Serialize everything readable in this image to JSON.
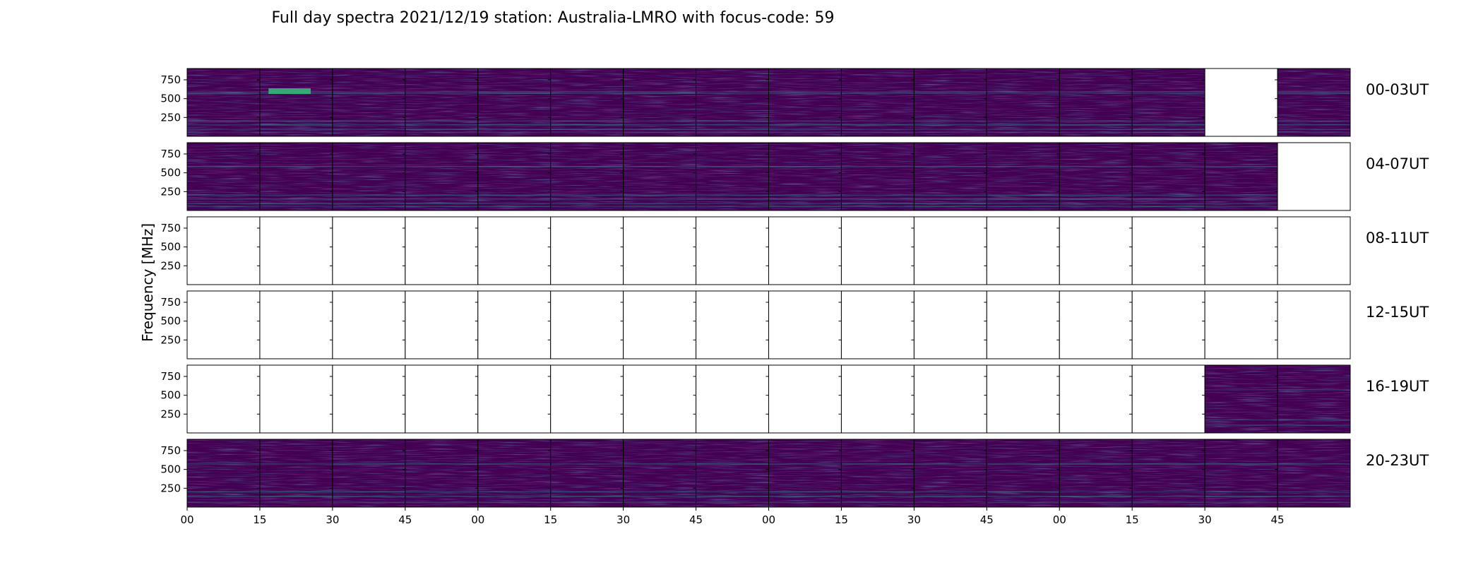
{
  "chart_data": {
    "type": "heatmap",
    "title": "Full day spectra 2021/12/19 station: Australia-LMRO with focus-code: 59",
    "ylabel": "Frequency [MHz]",
    "xlabel": "",
    "y_ticks": [
      "250",
      "500",
      "750"
    ],
    "x_ticks": [
      "00",
      "15",
      "30",
      "45",
      "00",
      "15",
      "30",
      "45",
      "00",
      "15",
      "30",
      "45",
      "00",
      "15",
      "30",
      "45"
    ],
    "colormap": "viridis",
    "background_color": "#440154",
    "rows": [
      {
        "label": "00-03UT",
        "panels": [
          true,
          true,
          true,
          true,
          true,
          true,
          true,
          true,
          true,
          true,
          true,
          true,
          true,
          true,
          false,
          true
        ],
        "bands": [
          {
            "freq": 600,
            "strength": 0.35
          },
          {
            "freq": 580,
            "strength": 0.45
          },
          {
            "freq": 210,
            "strength": 0.4
          },
          {
            "freq": 160,
            "strength": 0.5
          },
          {
            "freq": 100,
            "strength": 0.45
          },
          {
            "freq": 60,
            "strength": 0.4
          }
        ],
        "burst": {
          "panel": 1,
          "freq": 600,
          "strength": 0.9
        }
      },
      {
        "label": "04-07UT",
        "panels": [
          true,
          true,
          true,
          true,
          true,
          true,
          true,
          true,
          true,
          true,
          true,
          true,
          true,
          true,
          true,
          false
        ],
        "bands": [
          {
            "freq": 590,
            "strength": 0.45
          },
          {
            "freq": 210,
            "strength": 0.45
          },
          {
            "freq": 160,
            "strength": 0.5
          },
          {
            "freq": 100,
            "strength": 0.45
          },
          {
            "freq": 60,
            "strength": 0.4
          }
        ]
      },
      {
        "label": "08-11UT",
        "panels": [
          false,
          false,
          false,
          false,
          false,
          false,
          false,
          false,
          false,
          false,
          false,
          false,
          false,
          false,
          false,
          false
        ],
        "bands": []
      },
      {
        "label": "12-15UT",
        "panels": [
          false,
          false,
          false,
          false,
          false,
          false,
          false,
          false,
          false,
          false,
          false,
          false,
          false,
          false,
          false,
          false
        ],
        "bands": []
      },
      {
        "label": "16-19UT",
        "panels": [
          false,
          false,
          false,
          false,
          false,
          false,
          false,
          false,
          false,
          false,
          false,
          false,
          false,
          false,
          true,
          true
        ],
        "bands": [
          {
            "freq": 580,
            "strength": 0.35
          },
          {
            "freq": 180,
            "strength": 0.45
          },
          {
            "freq": 110,
            "strength": 0.4
          }
        ]
      },
      {
        "label": "20-23UT",
        "panels": [
          true,
          true,
          true,
          true,
          true,
          true,
          true,
          true,
          true,
          true,
          true,
          true,
          true,
          true,
          true,
          true
        ],
        "bands": [
          {
            "freq": 580,
            "strength": 0.45
          },
          {
            "freq": 210,
            "strength": 0.4
          },
          {
            "freq": 150,
            "strength": 0.45
          },
          {
            "freq": 70,
            "strength": 0.4
          }
        ]
      }
    ]
  }
}
